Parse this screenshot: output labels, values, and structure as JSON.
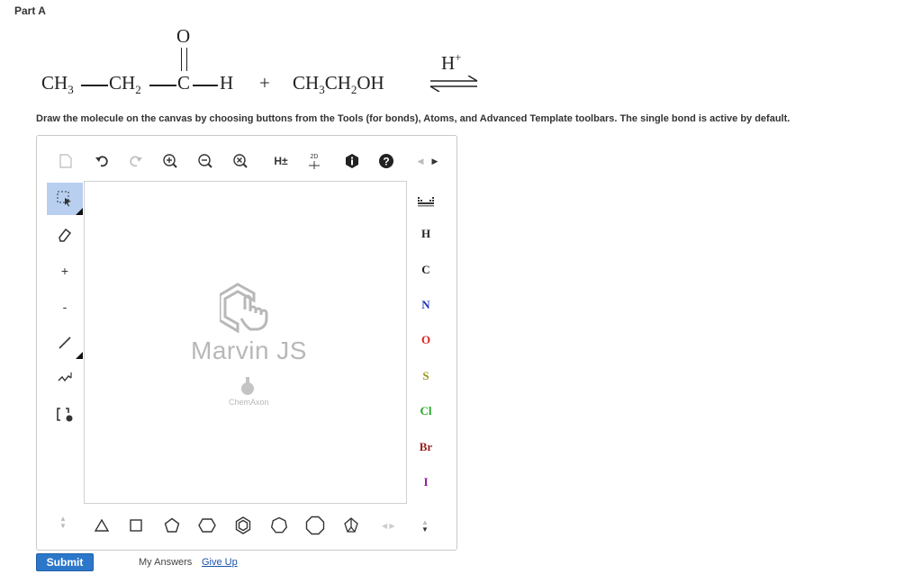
{
  "part": {
    "title": "Part A"
  },
  "reaction": {
    "oxygen": "O",
    "ch3": "CH",
    "ch3_sub": "3",
    "ch2": "CH",
    "ch2_sub": "2",
    "carbonyl_c": "C",
    "h": "H",
    "plus": "+",
    "ethanol_1": "CH",
    "ethanol_1_sub": "3",
    "ethanol_2": "CH",
    "ethanol_2_sub": "2",
    "ethanol_3": "OH",
    "catalyst": "H",
    "catalyst_sup": "+"
  },
  "instructions": "Draw the molecule on the canvas by choosing buttons from the Tools (for bonds), Atoms, and Advanced Template toolbars. The single bond is active by default.",
  "editor": {
    "top_toolbar": {
      "h_toggle_label": "H±",
      "label_2d": "2D"
    },
    "left_toolbar": {
      "plus_label": "+",
      "minus_label": "-"
    },
    "canvas": {
      "logo_text": "Marvin JS",
      "logo_sub": "ChemAxon"
    },
    "atoms": [
      {
        "label": "H",
        "color": "#222222"
      },
      {
        "label": "C",
        "color": "#222222"
      },
      {
        "label": "N",
        "color": "#2233bb"
      },
      {
        "label": "O",
        "color": "#dd2222"
      },
      {
        "label": "S",
        "color": "#999922"
      },
      {
        "label": "Cl",
        "color": "#22aa22"
      },
      {
        "label": "Br",
        "color": "#992222"
      },
      {
        "label": "I",
        "color": "#882299"
      }
    ],
    "selected_tool_color": "#b9cff0"
  },
  "footer": {
    "submit_label": "Submit",
    "my_answers_label": "My Answers",
    "give_up_label": "Give Up"
  }
}
